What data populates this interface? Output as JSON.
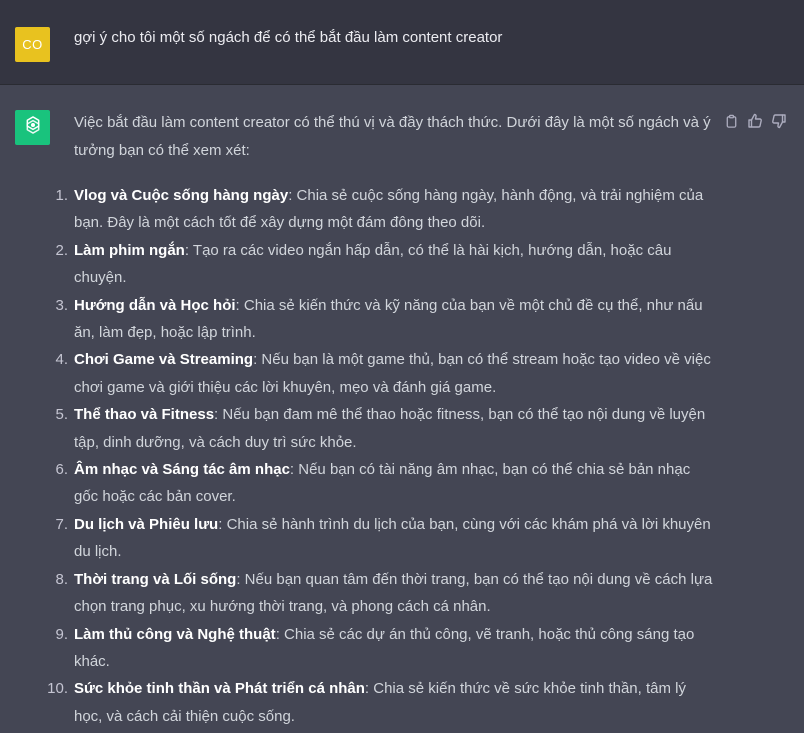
{
  "user": {
    "avatar_initials": "CO",
    "avatar_color": "#e8c21f",
    "message": "gợi ý cho tôi một số ngách để có thể bắt đầu làm content creator"
  },
  "assistant": {
    "avatar_icon": "openai-logo-icon",
    "avatar_color": "#19c37d",
    "actions": [
      "copy-icon",
      "thumbs-up-icon",
      "thumbs-down-icon"
    ],
    "intro": "Việc bắt đầu làm content creator có thể thú vị và đầy thách thức. Dưới đây là một số ngách và ý tưởng bạn có thể xem xét:",
    "items": [
      {
        "num": "1.",
        "title": "Vlog và Cuộc sống hàng ngày",
        "desc": ": Chia sẻ cuộc sống hàng ngày, hành động, và trải nghiệm của bạn. Đây là một cách tốt để xây dựng một đám đông theo dõi."
      },
      {
        "num": "2.",
        "title": "Làm phim ngắn",
        "desc": ": Tạo ra các video ngắn hấp dẫn, có thể là hài kịch, hướng dẫn, hoặc câu chuyện."
      },
      {
        "num": "3.",
        "title": "Hướng dẫn và Học hỏi",
        "desc": ": Chia sẻ kiến thức và kỹ năng của bạn về một chủ đề cụ thể, như nấu ăn, làm đẹp, hoặc lập trình."
      },
      {
        "num": "4.",
        "title": "Chơi Game và Streaming",
        "desc": ": Nếu bạn là một game thủ, bạn có thể stream hoặc tạo video về việc chơi game và giới thiệu các lời khuyên, mẹo và đánh giá game."
      },
      {
        "num": "5.",
        "title": "Thể thao và Fitness",
        "desc": ": Nếu bạn đam mê thể thao hoặc fitness, bạn có thể tạo nội dung về luyện tập, dinh dưỡng, và cách duy trì sức khỏe."
      },
      {
        "num": "6.",
        "title": "Âm nhạc và Sáng tác âm nhạc",
        "desc": ": Nếu bạn có tài năng âm nhạc, bạn có thể chia sẻ bản nhạc gốc hoặc các bản cover."
      },
      {
        "num": "7.",
        "title": "Du lịch và Phiêu lưu",
        "desc": ": Chia sẻ hành trình du lịch của bạn, cùng với các khám phá và lời khuyên du lịch."
      },
      {
        "num": "8.",
        "title": "Thời trang và Lối sống",
        "desc": ": Nếu bạn quan tâm đến thời trang, bạn có thể tạo nội dung về cách lựa chọn trang phục, xu hướng thời trang, và phong cách cá nhân."
      },
      {
        "num": "9.",
        "title": "Làm thủ công và Nghệ thuật",
        "desc": ": Chia sẻ các dự án thủ công, vẽ tranh, hoặc thủ công sáng tạo khác."
      },
      {
        "num": "10.",
        "title": "Sức khỏe tinh thần và Phát triển cá nhân",
        "desc": ": Chia sẻ kiến thức về sức khỏe tinh thần, tâm lý học, và cách cải thiện cuộc sống."
      }
    ]
  }
}
